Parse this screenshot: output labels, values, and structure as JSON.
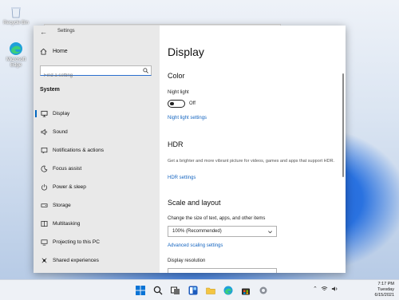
{
  "desktop": {
    "icons": [
      {
        "label": "Recycle Bin",
        "icon": "recycle-bin-icon"
      },
      {
        "label": "Microsoft Edge",
        "icon": "edge-icon"
      }
    ]
  },
  "window": {
    "title": "Settings",
    "back_icon": "back-arrow-icon",
    "controls": {
      "minimize": "—",
      "maximize": "□",
      "close": "✕"
    }
  },
  "sidebar": {
    "home_label": "Home",
    "search_placeholder": "Find a setting",
    "section_label": "System",
    "items": [
      {
        "label": "Display",
        "icon": "monitor-icon",
        "active": true
      },
      {
        "label": "Sound",
        "icon": "speaker-icon"
      },
      {
        "label": "Notifications & actions",
        "icon": "notification-icon"
      },
      {
        "label": "Focus assist",
        "icon": "moon-icon"
      },
      {
        "label": "Power & sleep",
        "icon": "power-icon"
      },
      {
        "label": "Storage",
        "icon": "storage-icon"
      },
      {
        "label": "Multitasking",
        "icon": "multitasking-icon"
      },
      {
        "label": "Projecting to this PC",
        "icon": "projecting-icon"
      },
      {
        "label": "Shared experiences",
        "icon": "shared-experiences-icon"
      }
    ]
  },
  "content": {
    "title": "Display",
    "color": {
      "heading": "Color",
      "night_light_label": "Night light",
      "night_light_state": "Off",
      "night_light_settings_link": "Night light settings"
    },
    "hdr": {
      "heading": "HDR",
      "description": "Get a brighter and more vibrant picture for videos, games and apps that support HDR.",
      "settings_link": "HDR settings"
    },
    "scale": {
      "heading": "Scale and layout",
      "size_label": "Change the size of text, apps, and other items",
      "size_value": "100% (Recommended)",
      "advanced_link": "Advanced scaling settings",
      "resolution_label": "Display resolution"
    }
  },
  "taskbar": {
    "icons": [
      "start-icon",
      "search-icon",
      "task-view-icon",
      "widgets-icon",
      "file-explorer-icon",
      "edge-icon",
      "store-icon",
      "settings-icon"
    ],
    "time": "7:17 PM",
    "day": "Tuesday",
    "date": "6/15/2021"
  },
  "colors": {
    "accent": "#0067c0",
    "link": "#1565c0",
    "sidebar_bg": "#e9e9e9"
  }
}
